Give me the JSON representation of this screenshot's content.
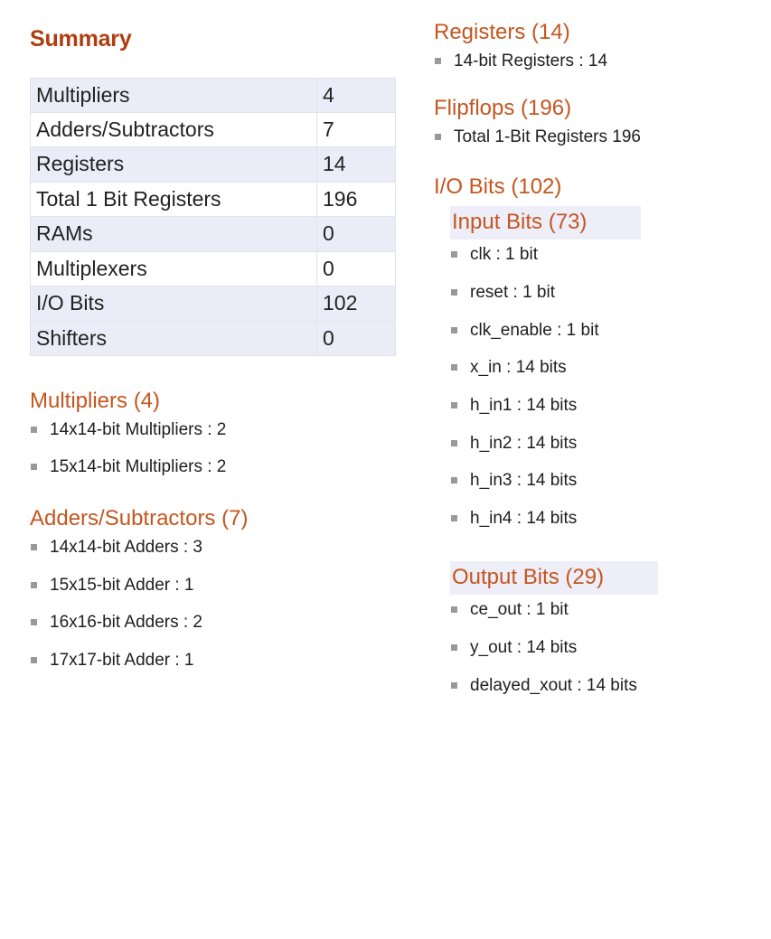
{
  "summary": {
    "title": "Summary",
    "table": {
      "rows": [
        {
          "label": "Multipliers",
          "value": "4",
          "shaded": true
        },
        {
          "label": "Adders/Subtractors",
          "value": "7",
          "shaded": false
        },
        {
          "label": "Registers",
          "value": "14",
          "shaded": true
        },
        {
          "label": "Total 1 Bit Registers",
          "value": "196",
          "shaded": false
        },
        {
          "label": "RAMs",
          "value": "0",
          "shaded": true
        },
        {
          "label": "Multiplexers",
          "value": "0",
          "shaded": false
        },
        {
          "label": "I/O Bits",
          "value": "102",
          "shaded": true
        },
        {
          "label": "Shifters",
          "value": "0",
          "shaded": true
        }
      ]
    }
  },
  "left_sections": [
    {
      "title": "Multipliers (4)",
      "items": [
        "14x14-bit Multipliers : 2",
        "15x14-bit Multipliers : 2"
      ]
    },
    {
      "title": "Adders/Subtractors (7)",
      "items": [
        "14x14-bit Adders : 3",
        "15x15-bit Adder : 1",
        "16x16-bit Adders : 2",
        "17x17-bit Adder : 1"
      ]
    }
  ],
  "right_sections": {
    "registers": {
      "title": "Registers (14)",
      "items": [
        "14-bit Registers : 14"
      ]
    },
    "flipflops": {
      "title": "Flipflops (196)",
      "items": [
        "Total 1-Bit Registers 196"
      ]
    },
    "iobits": {
      "title": "I/O Bits (102)",
      "input": {
        "title": "Input Bits (73)",
        "items": [
          "clk : 1 bit",
          "reset : 1 bit",
          "clk_enable : 1 bit",
          "x_in : 14 bits",
          "h_in1 : 14 bits",
          "h_in2 : 14 bits",
          "h_in3 : 14 bits",
          "h_in4 : 14 bits"
        ]
      },
      "output": {
        "title": "Output Bits (29)",
        "items": [
          "ce_out : 1 bit",
          "y_out : 14 bits",
          "delayed_xout : 14 bits"
        ]
      }
    }
  },
  "colors": {
    "summary_heading": "#b23c10",
    "section_heading": "#c4561f",
    "row_shade": "#ececf8",
    "highlight_band": "#eeeef9",
    "bullet": "#999999"
  }
}
